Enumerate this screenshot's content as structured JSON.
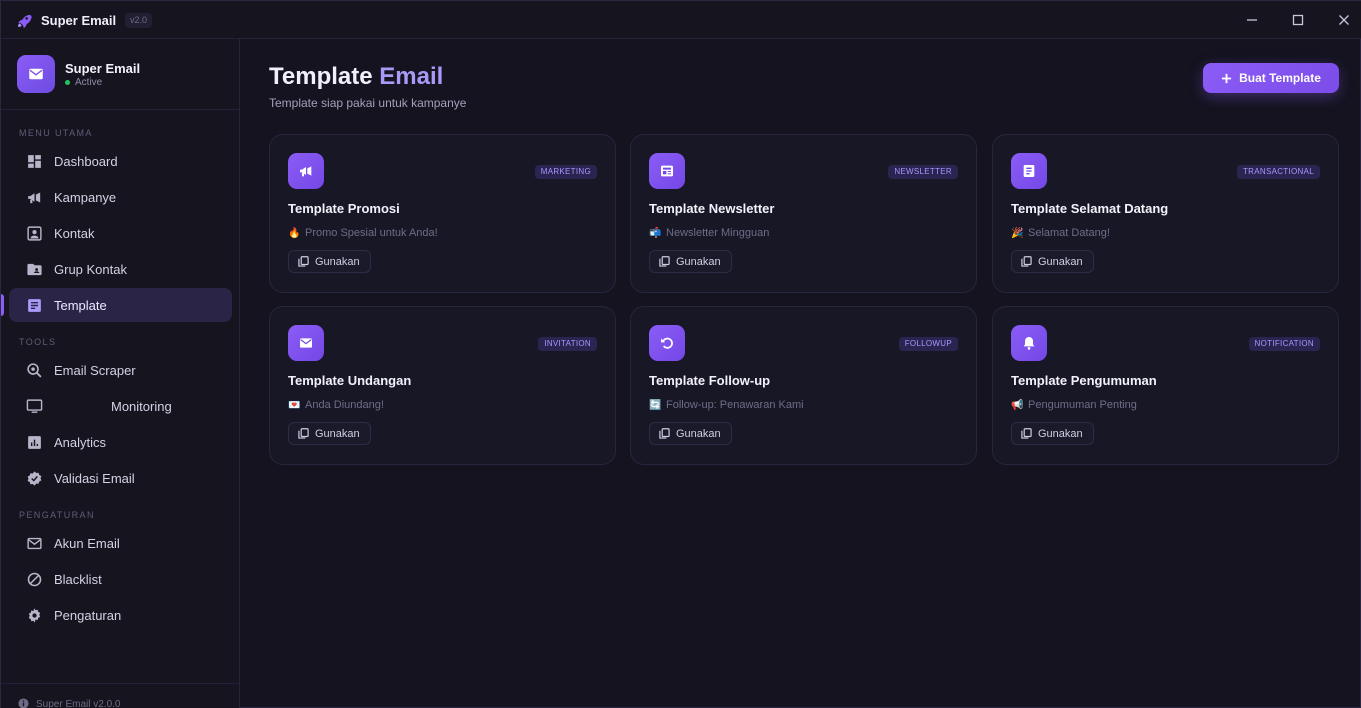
{
  "titlebar": {
    "title": "Super Email",
    "version": "v2.0"
  },
  "brand": {
    "name": "Super Email",
    "status": "Active"
  },
  "sidebar": {
    "sections": [
      {
        "label": "MENU UTAMA"
      },
      {
        "label": "TOOLS"
      },
      {
        "label": "PENGATURAN"
      }
    ],
    "items": [
      {
        "label": "Dashboard",
        "icon": "dashboard-icon"
      },
      {
        "label": "Kampanye",
        "icon": "megaphone-icon"
      },
      {
        "label": "Kontak",
        "icon": "contact-icon"
      },
      {
        "label": "Grup Kontak",
        "icon": "folder-user-icon"
      },
      {
        "label": "Template",
        "icon": "document-icon",
        "active": true
      },
      {
        "label": "Email Scraper",
        "icon": "search-scan-icon"
      },
      {
        "label": "Monitoring",
        "icon": "monitor-icon"
      },
      {
        "label": "Analytics",
        "icon": "bar-chart-icon"
      },
      {
        "label": "Validasi Email",
        "icon": "verified-badge-icon"
      },
      {
        "label": "Akun Email",
        "icon": "mail-icon"
      },
      {
        "label": "Blacklist",
        "icon": "block-icon"
      },
      {
        "label": "Pengaturan",
        "icon": "gear-icon"
      }
    ],
    "footer": "Super Email v2.0.0"
  },
  "main": {
    "title_part1": "Template",
    "title_part2": "Email",
    "subtitle": "Template siap pakai untuk kampanye",
    "create_button": "Buat Template"
  },
  "templates": [
    {
      "title": "Template Promosi",
      "badge": "MARKETING",
      "emoji": "🔥",
      "subject": "Promo Spesial untuk Anda!",
      "icon": "megaphone-icon",
      "button": "Gunakan"
    },
    {
      "title": "Template Newsletter",
      "badge": "NEWSLETTER",
      "emoji": "📬",
      "subject": "Newsletter Mingguan",
      "icon": "newspaper-icon",
      "button": "Gunakan"
    },
    {
      "title": "Template Selamat Datang",
      "badge": "TRANSACTIONAL",
      "emoji": "🎉",
      "subject": "Selamat Datang!",
      "icon": "document-icon",
      "button": "Gunakan"
    },
    {
      "title": "Template Undangan",
      "badge": "INVITATION",
      "emoji": "💌",
      "subject": "Anda Diundang!",
      "icon": "mail-icon",
      "button": "Gunakan"
    },
    {
      "title": "Template Follow-up",
      "badge": "FOLLOWUP",
      "emoji": "🔄",
      "subject": "Follow-up: Penawaran Kami",
      "icon": "refresh-icon",
      "button": "Gunakan"
    },
    {
      "title": "Template Pengumuman",
      "badge": "NOTIFICATION",
      "emoji": "📢",
      "subject": "Pengumuman Penting",
      "icon": "bell-icon",
      "button": "Gunakan"
    }
  ],
  "colors": {
    "background": "#14131f",
    "sidebar": "#16151f",
    "accent": "#8b5cf6",
    "accent_light": "#a99af7",
    "card": "#181726",
    "status_active": "#22c55e"
  }
}
